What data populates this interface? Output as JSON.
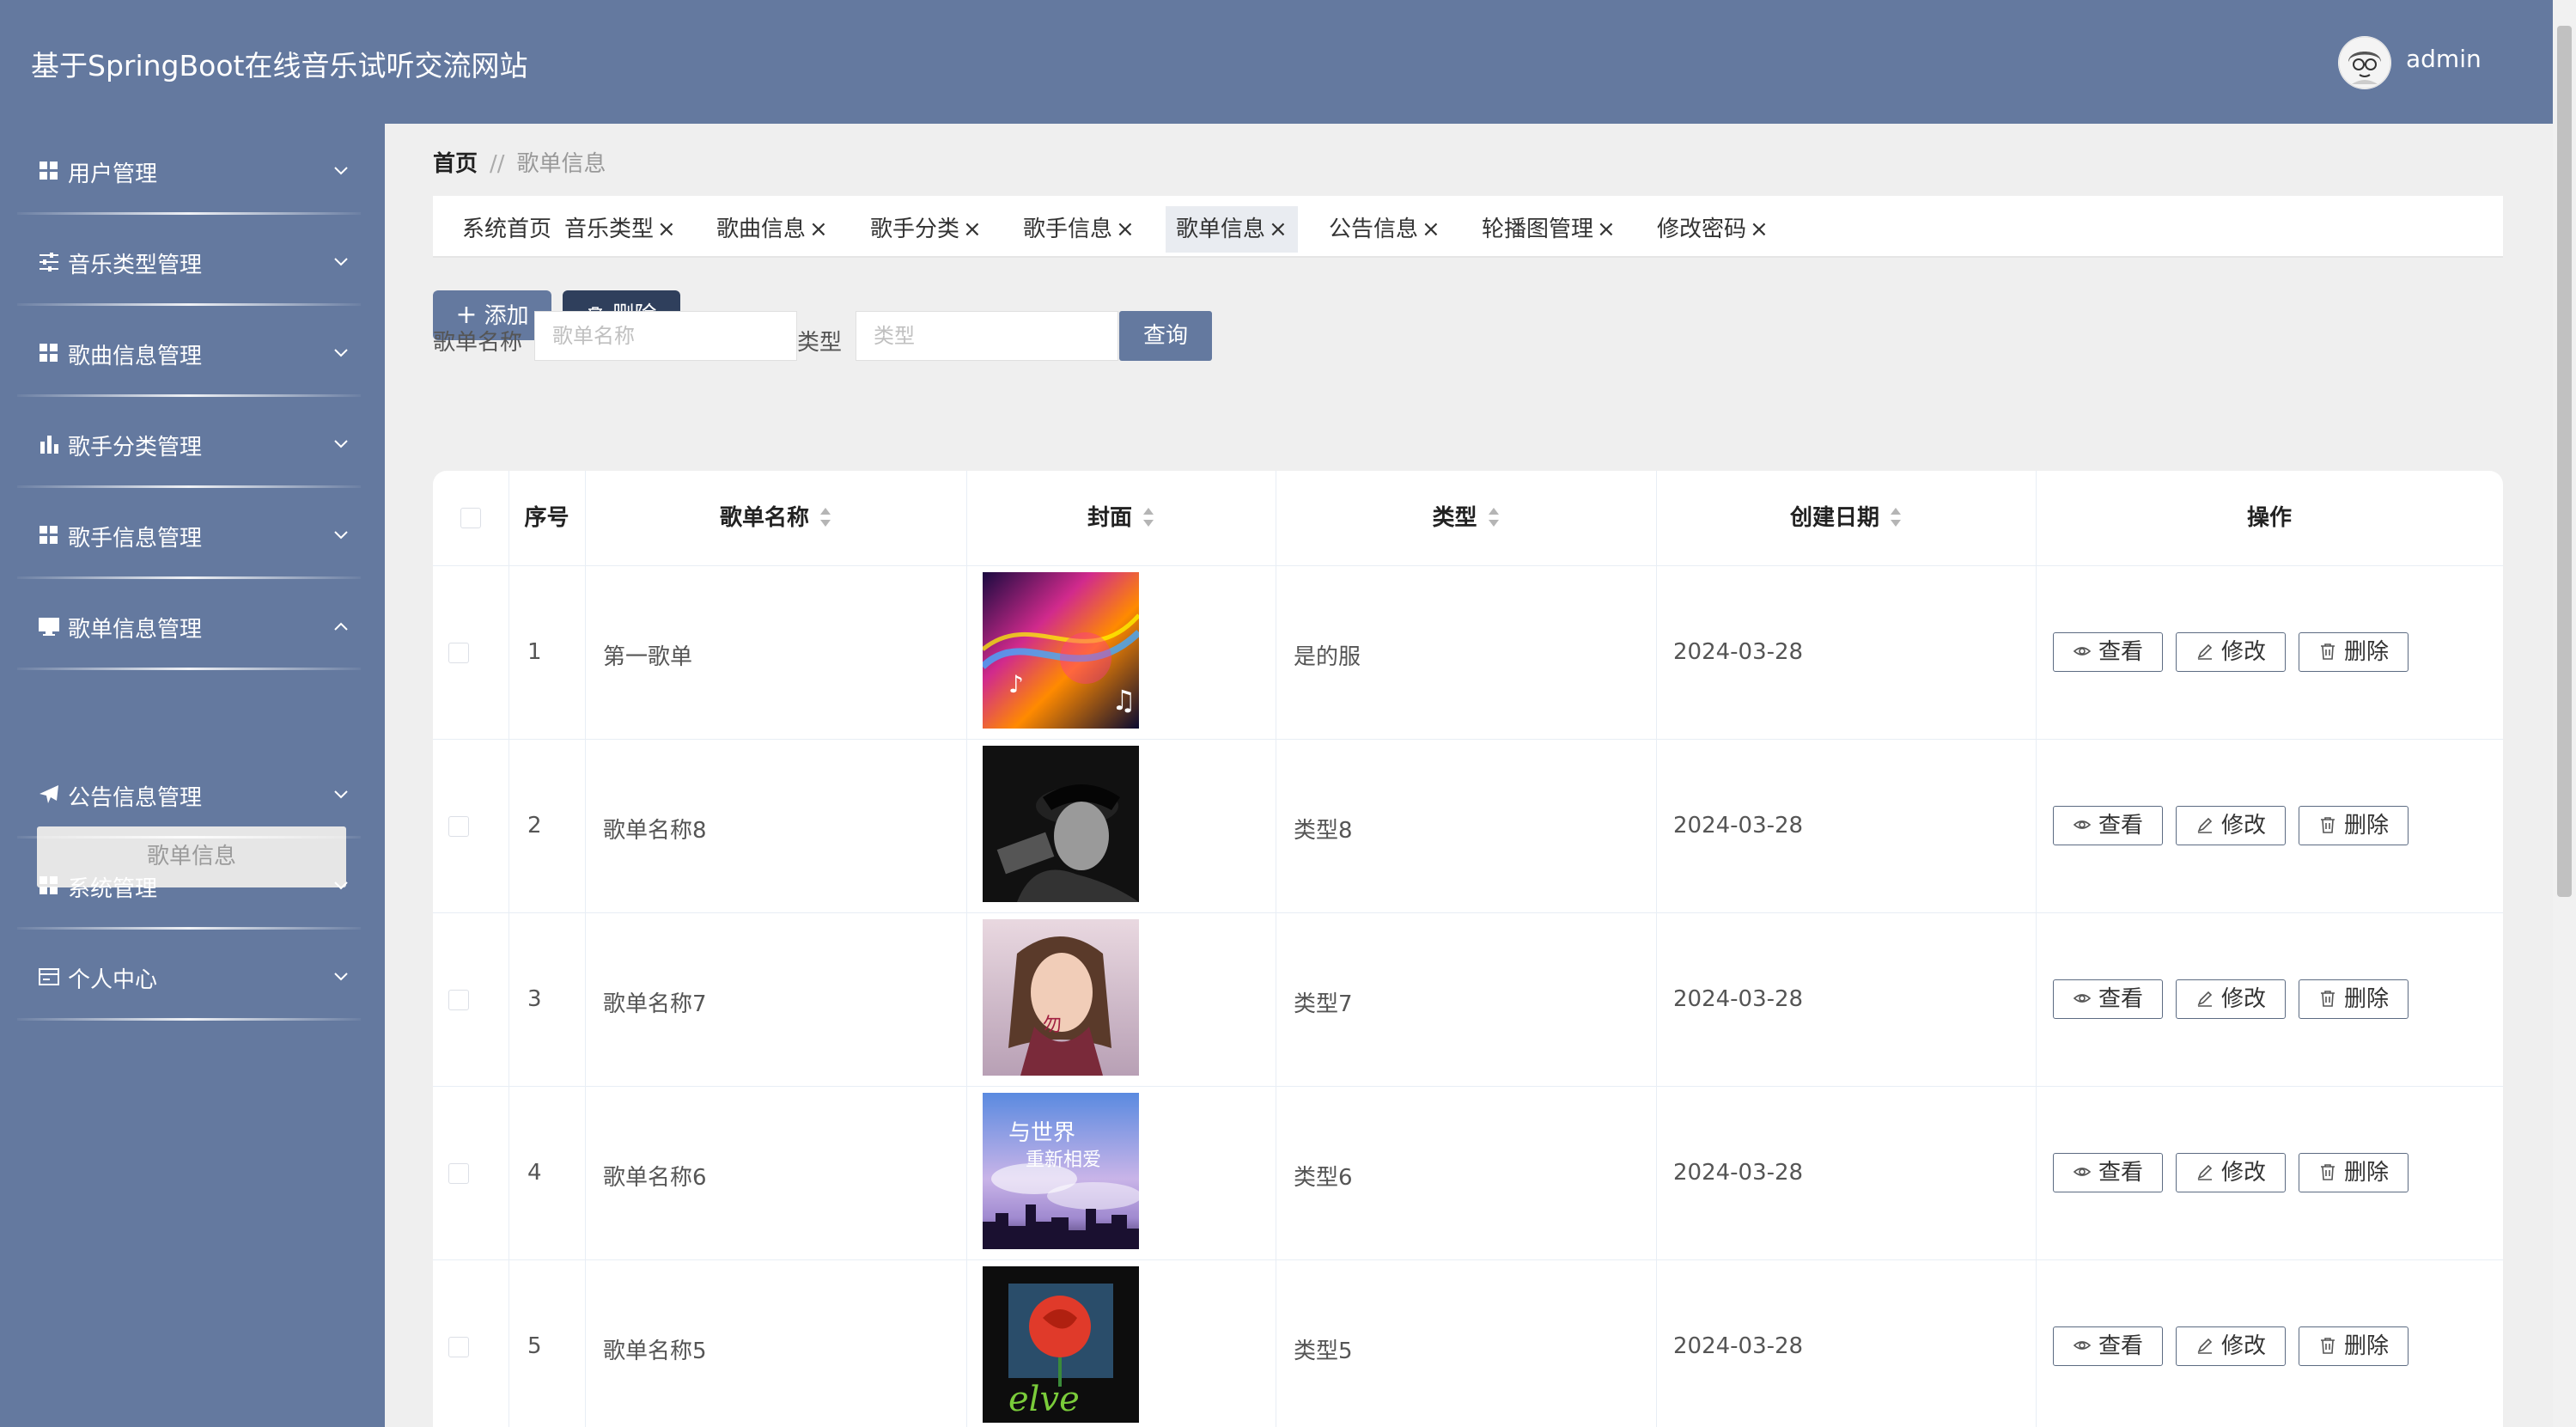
{
  "app": {
    "title": "基于SpringBoot在线音乐试听交流网站",
    "username": "admin"
  },
  "sidebar": {
    "items": [
      {
        "label": "用户管理",
        "icon": "grid-icon"
      },
      {
        "label": "音乐类型管理",
        "icon": "sliders-icon"
      },
      {
        "label": "歌曲信息管理",
        "icon": "grid-icon"
      },
      {
        "label": "歌手分类管理",
        "icon": "bar-chart-icon"
      },
      {
        "label": "歌手信息管理",
        "icon": "grid-icon"
      },
      {
        "label": "歌单信息管理",
        "icon": "monitor-icon",
        "expanded": true
      },
      {
        "label": "公告信息管理",
        "icon": "paper-plane-icon"
      },
      {
        "label": "系统管理",
        "icon": "grid-icon"
      },
      {
        "label": "个人中心",
        "icon": "card-icon"
      }
    ],
    "sub_item": "歌单信息"
  },
  "breadcrumb": {
    "home": "首页",
    "separator": "//",
    "current": "歌单信息"
  },
  "tabs": [
    {
      "label": "系统首页",
      "closable": false
    },
    {
      "label": "音乐类型",
      "closable": true
    },
    {
      "label": "歌曲信息",
      "closable": true
    },
    {
      "label": "歌手分类",
      "closable": true
    },
    {
      "label": "歌手信息",
      "closable": true
    },
    {
      "label": "歌单信息",
      "closable": true,
      "active": true
    },
    {
      "label": "公告信息",
      "closable": true
    },
    {
      "label": "轮播图管理",
      "closable": true
    },
    {
      "label": "修改密码",
      "closable": true
    }
  ],
  "toolbar": {
    "add_label": "添加",
    "delete_label": "删除"
  },
  "search": {
    "name_label": "歌单名称",
    "name_placeholder": "歌单名称",
    "type_label": "类型",
    "type_placeholder": "类型",
    "query_label": "查询"
  },
  "table": {
    "headers": {
      "index": "序号",
      "name": "歌单名称",
      "cover": "封面",
      "type": "类型",
      "date": "创建日期",
      "ops": "操作"
    },
    "rows": [
      {
        "index": "1",
        "name": "第一歌单",
        "type": "是的服",
        "date": "2024-03-28",
        "cover": "colorful-music-notes"
      },
      {
        "index": "2",
        "name": "歌单名称8",
        "type": "类型8",
        "date": "2024-03-28",
        "cover": "bw-man-portrait"
      },
      {
        "index": "3",
        "name": "歌单名称7",
        "type": "类型7",
        "date": "2024-03-28",
        "cover": "woman-portrait"
      },
      {
        "index": "4",
        "name": "歌单名称6",
        "type": "类型6",
        "date": "2024-03-28",
        "cover": "sky-city-skyline"
      },
      {
        "index": "5",
        "name": "歌单名称5",
        "type": "类型5",
        "date": "2024-03-28",
        "cover": "red-rose-love"
      }
    ],
    "actions": {
      "view": "查看",
      "edit": "修改",
      "delete": "删除"
    }
  },
  "colors": {
    "primary": "#64799f",
    "dark_button": "#2f3f5c",
    "background": "#efefef"
  }
}
